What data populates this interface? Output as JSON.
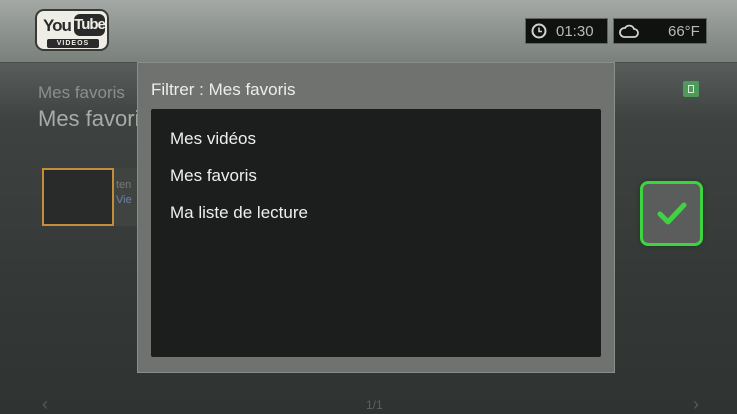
{
  "header": {
    "logo_you": "You",
    "logo_tube": "Tube",
    "logo_videos": "VIDEOS",
    "time": "01:30",
    "temperature": "66°F",
    "clock_icon": "clock-icon",
    "weather_icon": "cloud-icon"
  },
  "background": {
    "title_small": "Mes favoris",
    "title_large": "Mes favoris",
    "item_text_1": "ten",
    "item_text_2": "Vie",
    "pager": "1/1"
  },
  "dialog": {
    "title": "Filtrer : Mes favoris",
    "options": [
      "Mes vidéos",
      "Mes favoris",
      "Ma liste de lecture"
    ]
  },
  "colors": {
    "focus": "#3ed341",
    "thumb_border": "#c58c3a"
  }
}
